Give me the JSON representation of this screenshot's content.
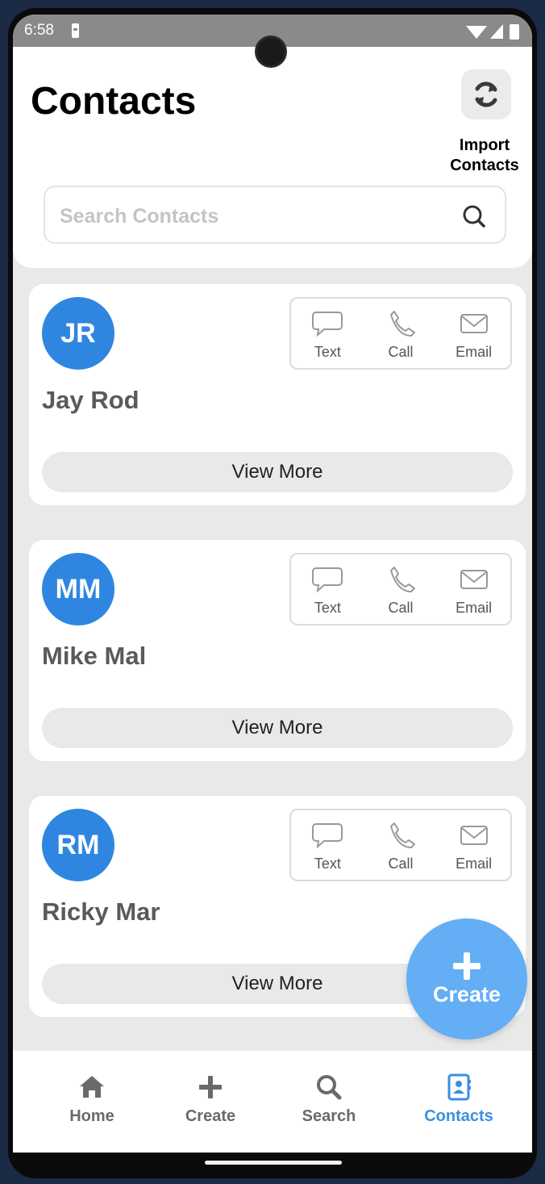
{
  "status_bar": {
    "time": "6:58"
  },
  "header": {
    "title": "Contacts",
    "import_label": "Import Contacts",
    "search_placeholder": "Search Contacts"
  },
  "contacts": [
    {
      "initials": "JR",
      "name": "Jay Rod"
    },
    {
      "initials": "MM",
      "name": "Mike Mal"
    },
    {
      "initials": "RM",
      "name": "Ricky Mar"
    }
  ],
  "contact_actions": {
    "text": "Text",
    "call": "Call",
    "email": "Email"
  },
  "view_more_label": "View More",
  "fab": {
    "label": "Create"
  },
  "bottom_nav": {
    "items": [
      {
        "label": "Home",
        "icon": "home-icon"
      },
      {
        "label": "Create",
        "icon": "plus-icon"
      },
      {
        "label": "Search",
        "icon": "search-icon"
      },
      {
        "label": "Contacts",
        "icon": "contacts-book-icon",
        "active": true
      }
    ]
  },
  "colors": {
    "accent": "#2f86e0",
    "fab": "#63aef5",
    "active_nav": "#3a8fe0"
  }
}
